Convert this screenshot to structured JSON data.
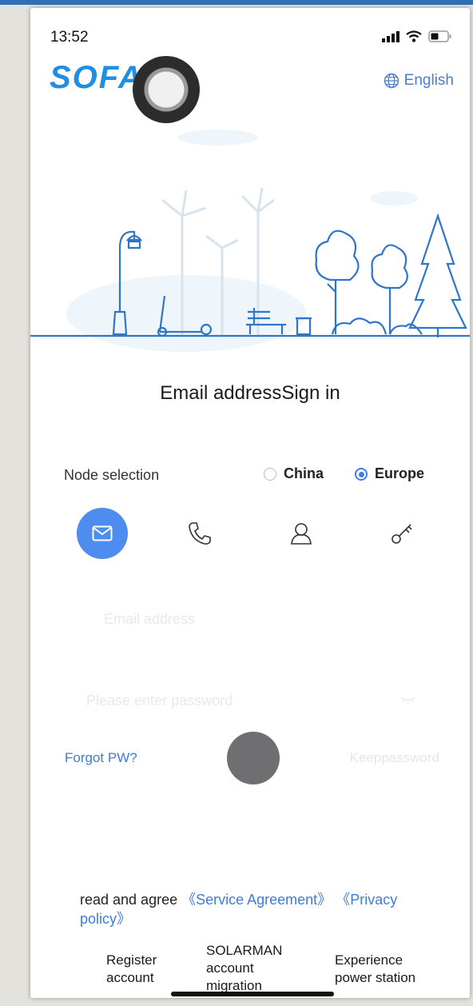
{
  "status_bar": {
    "time": "13:52"
  },
  "header": {
    "logo_text": "SOFAR",
    "language": "English"
  },
  "title": "Email addressSign in",
  "node_selection": {
    "label": "Node selection",
    "options": [
      {
        "label": "China",
        "selected": false
      },
      {
        "label": "Europe",
        "selected": true
      }
    ]
  },
  "login_tabs": [
    {
      "icon": "mail-icon",
      "active": true
    },
    {
      "icon": "phone-icon",
      "active": false
    },
    {
      "icon": "user-icon",
      "active": false
    },
    {
      "icon": "key-icon",
      "active": false
    }
  ],
  "form": {
    "email_placeholder": "Email address",
    "password_placeholder": "Please enter password",
    "forgot_label": "Forgot PW?",
    "keep_label": "Keeppassword"
  },
  "agreement": {
    "prefix": "read and agree ",
    "service_link": "《Service Agreement》",
    "privacy_link": "《Privacy policy》"
  },
  "bottom_links": {
    "register": "Register account",
    "migration": "SOLARMAN account migration",
    "experience": "Experience power station"
  },
  "colors": {
    "accent": "#4f8cf0",
    "link": "#3d7ed3",
    "illustration": "#2f76c9"
  }
}
